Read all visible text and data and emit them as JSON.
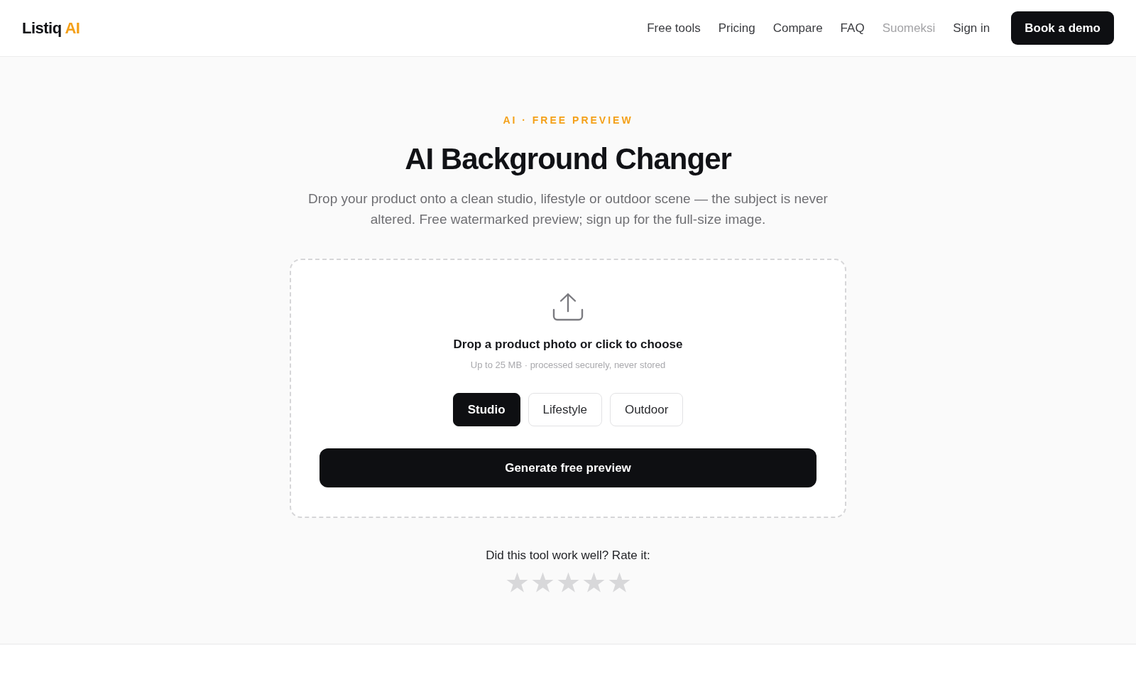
{
  "header": {
    "logo": {
      "text": "Listiq",
      "accent": "AI"
    },
    "nav": [
      {
        "label": "Free tools",
        "kind": "link"
      },
      {
        "label": "Pricing",
        "kind": "link"
      },
      {
        "label": "Compare",
        "kind": "link"
      },
      {
        "label": "FAQ",
        "kind": "link"
      },
      {
        "label": "Suomeksi",
        "kind": "language"
      },
      {
        "label": "Sign in",
        "kind": "link"
      }
    ],
    "cta": "Book a demo"
  },
  "hero": {
    "eyebrow": "AI · FREE PREVIEW",
    "title": "AI Background Changer",
    "subtitle": "Drop your product onto a clean studio, lifestyle or outdoor scene — the subject is never altered. Free watermarked preview; sign up for the full-size image."
  },
  "upload": {
    "prompt": "Drop a product photo or click to choose",
    "hint": "Up to 25 MB · processed securely, never stored",
    "scenes": [
      {
        "label": "Studio",
        "selected": true
      },
      {
        "label": "Lifestyle",
        "selected": false
      },
      {
        "label": "Outdoor",
        "selected": false
      }
    ],
    "button": "Generate free preview"
  },
  "rating": {
    "question": "Did this tool work well? Rate it:",
    "stars": 0
  }
}
